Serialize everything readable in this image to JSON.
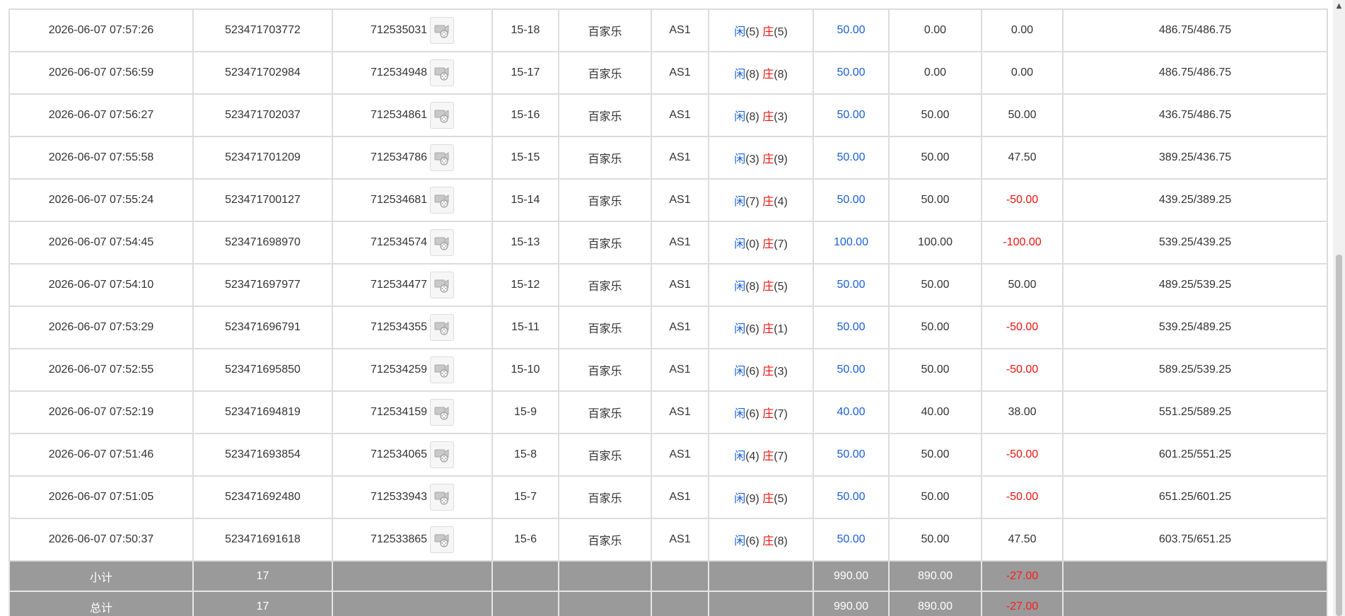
{
  "rows": [
    {
      "time": "2026-06-07 07:57:26",
      "bet_id": "523471703772",
      "round_id": "712535031",
      "shoe": "15-18",
      "game": "百家乐",
      "table": "AS1",
      "player_label": "闲",
      "player_score": "(5)",
      "banker_label": "庄",
      "banker_score": "(5)",
      "bet": "50.00",
      "valid_bet": "0.00",
      "win_loss": "0.00",
      "win_loss_color": "normal",
      "balance": "486.75/486.75"
    },
    {
      "time": "2026-06-07 07:56:59",
      "bet_id": "523471702984",
      "round_id": "712534948",
      "shoe": "15-17",
      "game": "百家乐",
      "table": "AS1",
      "player_label": "闲",
      "player_score": "(8)",
      "banker_label": "庄",
      "banker_score": "(8)",
      "bet": "50.00",
      "valid_bet": "0.00",
      "win_loss": "0.00",
      "win_loss_color": "normal",
      "balance": "486.75/486.75"
    },
    {
      "time": "2026-06-07 07:56:27",
      "bet_id": "523471702037",
      "round_id": "712534861",
      "shoe": "15-16",
      "game": "百家乐",
      "table": "AS1",
      "player_label": "闲",
      "player_score": "(8)",
      "banker_label": "庄",
      "banker_score": "(3)",
      "bet": "50.00",
      "valid_bet": "50.00",
      "win_loss": "50.00",
      "win_loss_color": "normal",
      "balance": "436.75/486.75"
    },
    {
      "time": "2026-06-07 07:55:58",
      "bet_id": "523471701209",
      "round_id": "712534786",
      "shoe": "15-15",
      "game": "百家乐",
      "table": "AS1",
      "player_label": "闲",
      "player_score": "(3)",
      "banker_label": "庄",
      "banker_score": "(9)",
      "bet": "50.00",
      "valid_bet": "50.00",
      "win_loss": "47.50",
      "win_loss_color": "normal",
      "balance": "389.25/436.75"
    },
    {
      "time": "2026-06-07 07:55:24",
      "bet_id": "523471700127",
      "round_id": "712534681",
      "shoe": "15-14",
      "game": "百家乐",
      "table": "AS1",
      "player_label": "闲",
      "player_score": "(7)",
      "banker_label": "庄",
      "banker_score": "(4)",
      "bet": "50.00",
      "valid_bet": "50.00",
      "win_loss": "-50.00",
      "win_loss_color": "red",
      "balance": "439.25/389.25"
    },
    {
      "time": "2026-06-07 07:54:45",
      "bet_id": "523471698970",
      "round_id": "712534574",
      "shoe": "15-13",
      "game": "百家乐",
      "table": "AS1",
      "player_label": "闲",
      "player_score": "(0)",
      "banker_label": "庄",
      "banker_score": "(7)",
      "bet": "100.00",
      "valid_bet": "100.00",
      "win_loss": "-100.00",
      "win_loss_color": "red",
      "balance": "539.25/439.25"
    },
    {
      "time": "2026-06-07 07:54:10",
      "bet_id": "523471697977",
      "round_id": "712534477",
      "shoe": "15-12",
      "game": "百家乐",
      "table": "AS1",
      "player_label": "闲",
      "player_score": "(8)",
      "banker_label": "庄",
      "banker_score": "(5)",
      "bet": "50.00",
      "valid_bet": "50.00",
      "win_loss": "50.00",
      "win_loss_color": "normal",
      "balance": "489.25/539.25"
    },
    {
      "time": "2026-06-07 07:53:29",
      "bet_id": "523471696791",
      "round_id": "712534355",
      "shoe": "15-11",
      "game": "百家乐",
      "table": "AS1",
      "player_label": "闲",
      "player_score": "(6)",
      "banker_label": "庄",
      "banker_score": "(1)",
      "bet": "50.00",
      "valid_bet": "50.00",
      "win_loss": "-50.00",
      "win_loss_color": "red",
      "balance": "539.25/489.25"
    },
    {
      "time": "2026-06-07 07:52:55",
      "bet_id": "523471695850",
      "round_id": "712534259",
      "shoe": "15-10",
      "game": "百家乐",
      "table": "AS1",
      "player_label": "闲",
      "player_score": "(6)",
      "banker_label": "庄",
      "banker_score": "(3)",
      "bet": "50.00",
      "valid_bet": "50.00",
      "win_loss": "-50.00",
      "win_loss_color": "red",
      "balance": "589.25/539.25"
    },
    {
      "time": "2026-06-07 07:52:19",
      "bet_id": "523471694819",
      "round_id": "712534159",
      "shoe": "15-9",
      "game": "百家乐",
      "table": "AS1",
      "player_label": "闲",
      "player_score": "(6)",
      "banker_label": "庄",
      "banker_score": "(7)",
      "bet": "40.00",
      "valid_bet": "40.00",
      "win_loss": "38.00",
      "win_loss_color": "normal",
      "balance": "551.25/589.25"
    },
    {
      "time": "2026-06-07 07:51:46",
      "bet_id": "523471693854",
      "round_id": "712534065",
      "shoe": "15-8",
      "game": "百家乐",
      "table": "AS1",
      "player_label": "闲",
      "player_score": "(4)",
      "banker_label": "庄",
      "banker_score": "(7)",
      "bet": "50.00",
      "valid_bet": "50.00",
      "win_loss": "-50.00",
      "win_loss_color": "red",
      "balance": "601.25/551.25"
    },
    {
      "time": "2026-06-07 07:51:05",
      "bet_id": "523471692480",
      "round_id": "712533943",
      "shoe": "15-7",
      "game": "百家乐",
      "table": "AS1",
      "player_label": "闲",
      "player_score": "(9)",
      "banker_label": "庄",
      "banker_score": "(5)",
      "bet": "50.00",
      "valid_bet": "50.00",
      "win_loss": "-50.00",
      "win_loss_color": "red",
      "balance": "651.25/601.25"
    },
    {
      "time": "2026-06-07 07:50:37",
      "bet_id": "523471691618",
      "round_id": "712533865",
      "shoe": "15-6",
      "game": "百家乐",
      "table": "AS1",
      "player_label": "闲",
      "player_score": "(6)",
      "banker_label": "庄",
      "banker_score": "(8)",
      "bet": "50.00",
      "valid_bet": "50.00",
      "win_loss": "47.50",
      "win_loss_color": "normal",
      "balance": "603.75/651.25"
    }
  ],
  "subtotal": {
    "label": "小计",
    "count": "17",
    "bet": "990.00",
    "valid_bet": "890.00",
    "win_loss": "-27.00"
  },
  "total": {
    "label": "总计",
    "count": "17",
    "bet": "990.00",
    "valid_bet": "890.00",
    "win_loss": "-27.00"
  },
  "icons": {
    "replay": "video-replay-icon",
    "scroll_up": "scroll-up-arrow-icon"
  },
  "colors": {
    "player": "#1a5fd6",
    "banker": "#e8120c",
    "bet": "#1a5fd6",
    "loss": "#e8120c",
    "summary_bg": "#9a9a9a"
  }
}
